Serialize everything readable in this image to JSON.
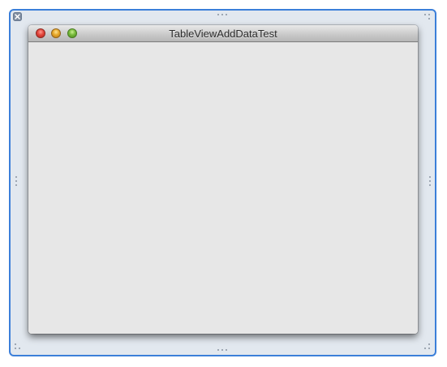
{
  "window": {
    "title": "TableViewAddDataTest"
  },
  "controls": {
    "close_icon": "close-icon",
    "minimize_icon": "minimize-icon",
    "zoom_icon": "zoom-icon"
  },
  "canvas": {
    "delete_icon": "delete-icon",
    "selection_color": "#3b7fd9",
    "background_color": "#e2e8ef"
  }
}
